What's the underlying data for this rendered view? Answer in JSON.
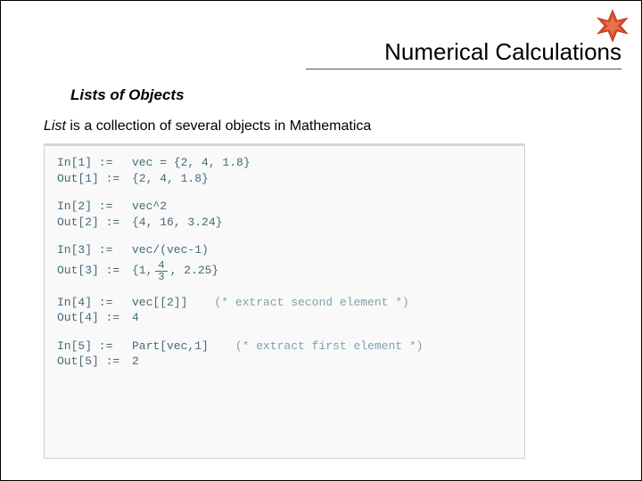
{
  "header": {
    "title": "Numerical Calculations"
  },
  "content": {
    "subtitle": "Lists of Objects",
    "intro_em": "List",
    "intro_rest": " is a collection of several objects in Mathematica"
  },
  "code": {
    "b1": {
      "in_lab": "In[1] :=",
      "in_expr": "vec = {2, 4, 1.8}",
      "out_lab": "Out[1] :=",
      "out_expr": "{2, 4, 1.8}"
    },
    "b2": {
      "in_lab": "In[2] :=",
      "in_expr": "vec^2",
      "out_lab": "Out[2] :=",
      "out_expr": "{4, 16, 3.24}"
    },
    "b3": {
      "in_lab": "In[3] :=",
      "in_expr": "vec/(vec-1)",
      "out_lab": "Out[3] :=",
      "out_pre": "{1, ",
      "frac_num": "4",
      "frac_den": "3",
      "out_post": ", 2.25}"
    },
    "b4": {
      "in_lab": "In[4] :=",
      "in_expr": "vec[[2]]",
      "in_cmt": "(* extract second element *)",
      "out_lab": "Out[4] :=",
      "out_expr": "4"
    },
    "b5": {
      "in_lab": "In[5] :=",
      "in_expr": "Part[vec,1]",
      "in_cmt": "(* extract first element *)",
      "out_lab": "Out[5] :=",
      "out_expr": "2"
    }
  }
}
